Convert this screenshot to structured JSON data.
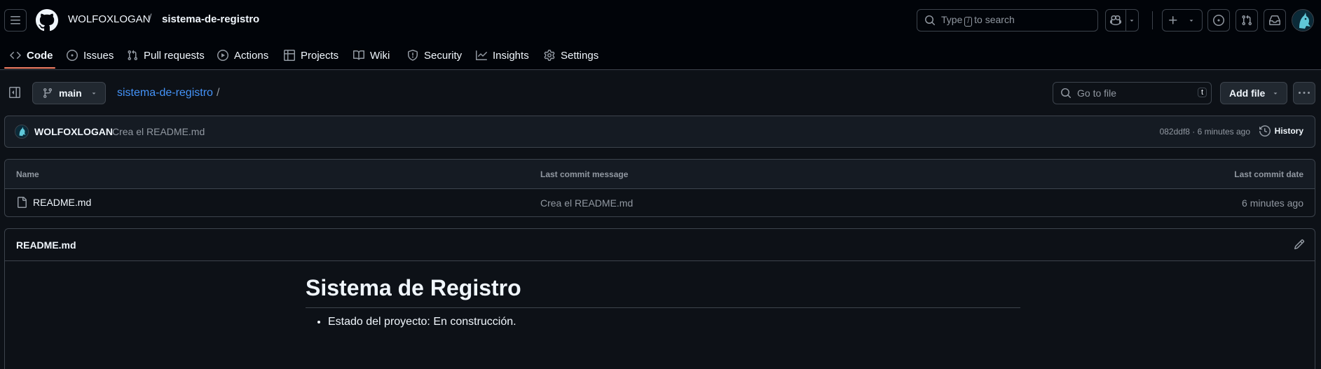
{
  "header": {
    "owner": "WOLFOXLOGAN",
    "separator": "/",
    "repo": "sistema-de-registro",
    "search_pre": "Type",
    "search_key": "/",
    "search_post": "to search"
  },
  "tabs": [
    {
      "label": "Code",
      "icon": "code-icon"
    },
    {
      "label": "Issues",
      "icon": "issue-icon"
    },
    {
      "label": "Pull requests",
      "icon": "pull-request-icon"
    },
    {
      "label": "Actions",
      "icon": "play-icon"
    },
    {
      "label": "Projects",
      "icon": "table-icon"
    },
    {
      "label": "Wiki",
      "icon": "book-icon"
    },
    {
      "label": "Security",
      "icon": "shield-icon"
    },
    {
      "label": "Insights",
      "icon": "graph-icon"
    },
    {
      "label": "Settings",
      "icon": "gear-icon"
    }
  ],
  "toolbar": {
    "branch": "main",
    "breadcrumb_repo": "sistema-de-registro",
    "breadcrumb_sep": "/",
    "go_to_file": "Go to file",
    "go_to_file_key": "t",
    "add_file": "Add file"
  },
  "commit": {
    "author": "WOLFOXLOGAN",
    "message": "Crea el README.md",
    "meta": "082ddf8 · 6 minutes ago",
    "history": "History"
  },
  "files": {
    "columns": [
      "Name",
      "Last commit message",
      "Last commit date"
    ],
    "rows": [
      {
        "name": "README.md",
        "message": "Crea el README.md",
        "date": "6 minutes ago"
      }
    ]
  },
  "readme": {
    "title": "README.md",
    "heading": "Sistema de Registro",
    "items": [
      "Estado del proyecto: En construcción."
    ]
  },
  "colors": {
    "background": "#010409",
    "surface": "#0d1117",
    "link": "#4493f8",
    "active_tab_underline": "#f78166"
  }
}
